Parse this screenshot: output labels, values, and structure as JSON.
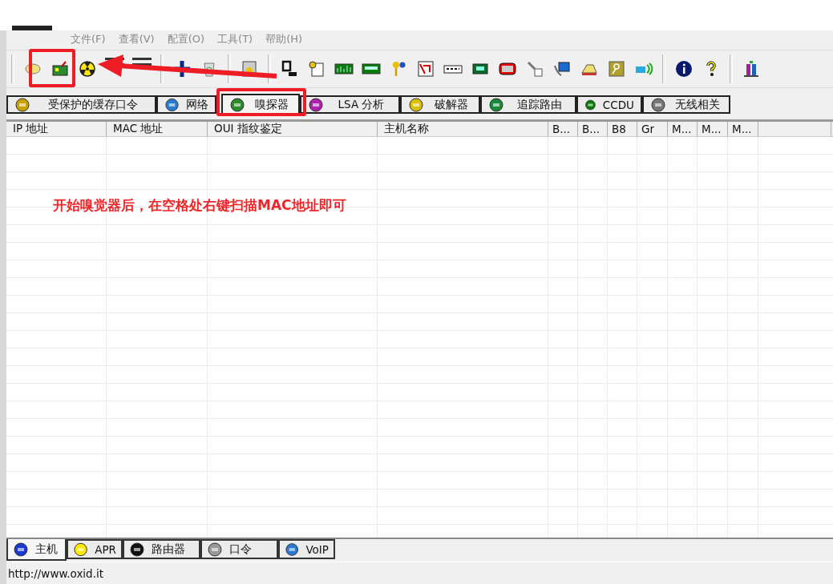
{
  "menu": [
    "文件(F)",
    "查看(V)",
    "配置(O)",
    "工具(T)",
    "帮助(H)"
  ],
  "tabs": [
    {
      "label": "受保护的缓存口令",
      "selected": false
    },
    {
      "label": "网络",
      "selected": false
    },
    {
      "label": "嗅探器",
      "selected": true
    },
    {
      "label": "LSA 分析",
      "selected": false
    },
    {
      "label": "破解器",
      "selected": false
    },
    {
      "label": "追踪路由",
      "selected": false
    },
    {
      "label": "CCDU",
      "selected": false
    },
    {
      "label": "无线相关",
      "selected": false
    }
  ],
  "table": {
    "columns": [
      "IP 地址",
      "MAC 地址",
      "OUI 指纹鉴定",
      "主机名称",
      "B...",
      "B...",
      "B8",
      "Gr",
      "M...",
      "M...",
      "M..."
    ]
  },
  "bottom_tabs": [
    {
      "label": "主机",
      "selected": true
    },
    {
      "label": "APR",
      "selected": false
    },
    {
      "label": "路由器",
      "selected": false
    },
    {
      "label": "口令",
      "selected": false
    },
    {
      "label": "VoIP",
      "selected": false
    }
  ],
  "status_bar": "http://www.oxid.it",
  "annotation": {
    "note": "开始嗅觉器后，在空格处右键扫描MAC地址即可"
  }
}
